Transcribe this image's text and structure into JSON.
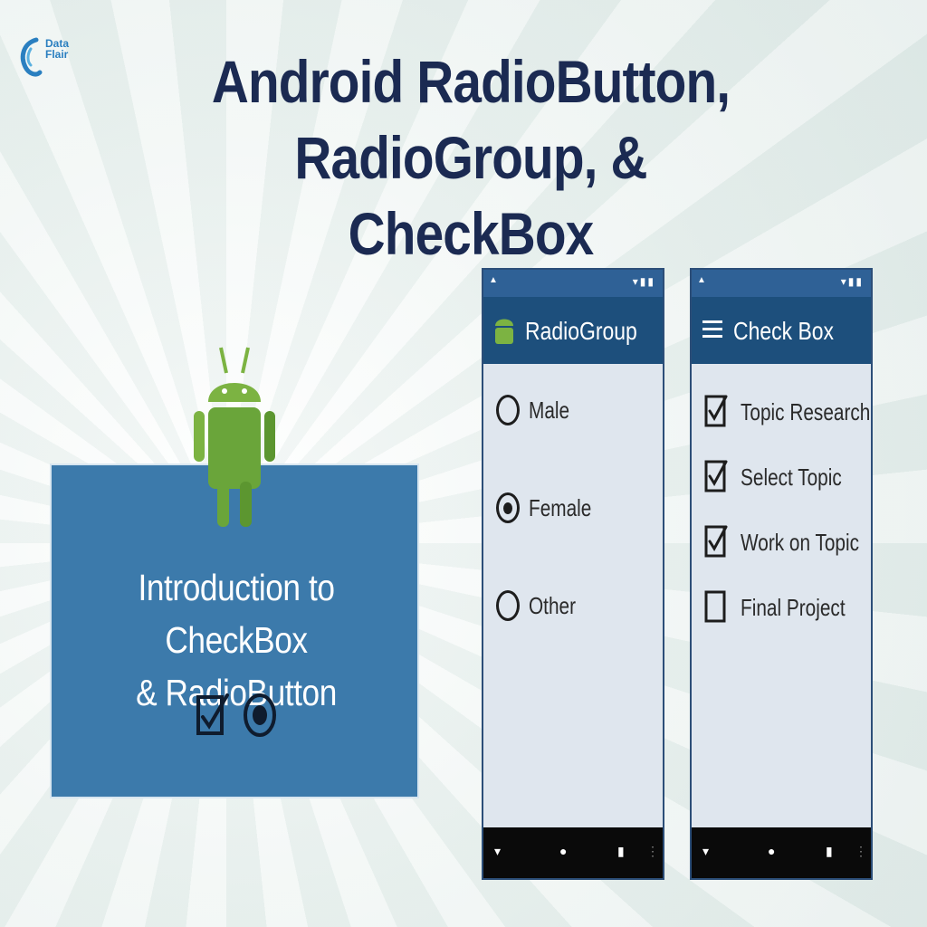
{
  "logo": {
    "text_line1": "Data",
    "text_line2": "Flair"
  },
  "headline": {
    "line1": "Android RadioButton,",
    "line2": "RadioGroup, & CheckBox"
  },
  "intro": {
    "line1": "Introduction to CheckBox",
    "line2": "& RadioButton"
  },
  "radio_phone": {
    "status_icons": "▾▮▮",
    "title": "RadioGroup",
    "options": [
      {
        "label": "Male",
        "selected": false
      },
      {
        "label": "Female",
        "selected": true
      },
      {
        "label": "Other",
        "selected": false
      }
    ]
  },
  "check_phone": {
    "status_icons": "▾▮▮",
    "title": "Check Box",
    "items": [
      {
        "label": "Topic Research",
        "checked": true
      },
      {
        "label": "Select Topic",
        "checked": true
      },
      {
        "label": "Work on Topic",
        "checked": true
      },
      {
        "label": "Final Project",
        "checked": false
      }
    ]
  },
  "colors": {
    "headline": "#1b2a52",
    "card": "#3c7aab",
    "app_bar": "#1d4f7c",
    "status_bar": "#2f6196",
    "android_green": "#7cb342"
  }
}
